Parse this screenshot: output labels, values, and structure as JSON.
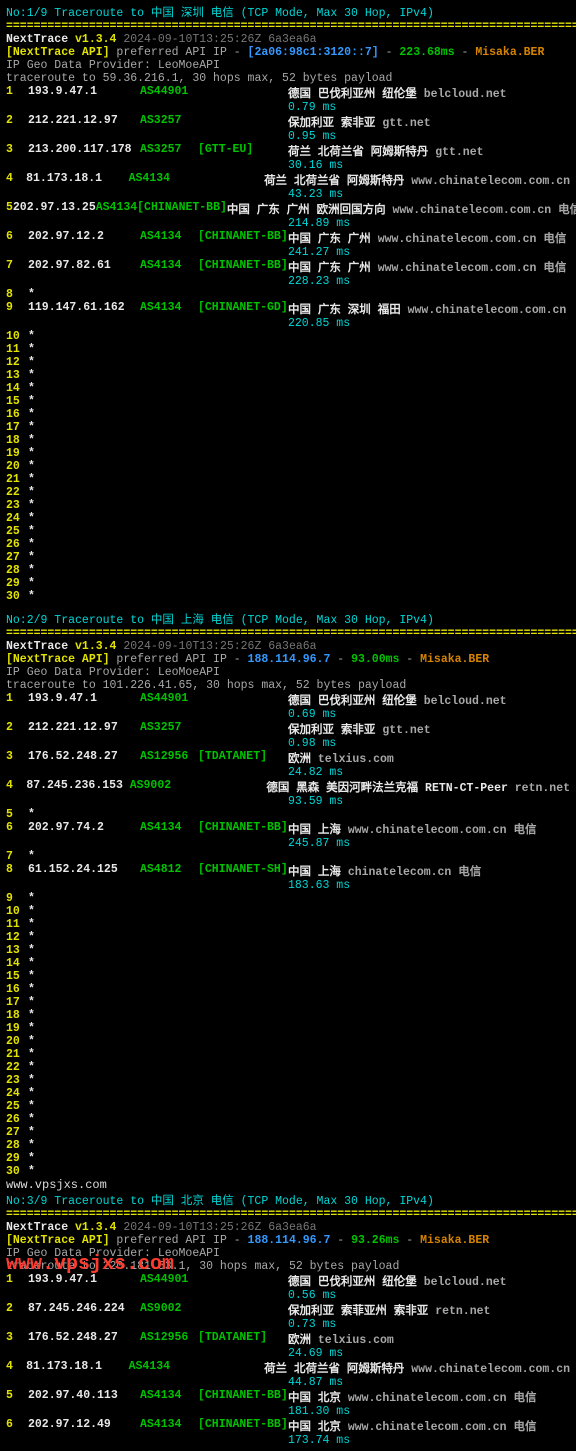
{
  "watermark": "www.vpsjxs.com",
  "blocks": [
    {
      "header": "No:1/9 Traceroute to 中国 深圳 电信 (TCP Mode, Max 30 Hop, IPv4)",
      "version": {
        "name": "NextTrace",
        "ver": "v1.3.4",
        "ts": "2024-09-10T13:25:26Z",
        "hash": "6a3ea6a"
      },
      "api_label": "[NextTrace API]",
      "api_text": "preferred API IP -",
      "api_ip": "[2a06:98c1:3120::7]",
      "api_sep": "-",
      "api_lat": "223.68ms",
      "api_sep2": "-",
      "api_node": "Misaka.BER",
      "provider": "IP Geo Data Provider: LeoMoeAPI",
      "target": "traceroute to 59.36.216.1, 30 hops max, 52 bytes payload",
      "hops": [
        {
          "n": "1",
          "ip": "193.9.47.1",
          "asn": "AS44901",
          "tag": "",
          "loc": "德国 巴伐利亚州 纽伦堡",
          "host": "belcloud.net",
          "peer": "",
          "lat": "0.79 ms"
        },
        {
          "n": "2",
          "ip": "212.221.12.97",
          "asn": "AS3257",
          "tag": "",
          "loc": "保加利亚 索非亚",
          "host": "gtt.net",
          "peer": "",
          "lat": "0.95 ms"
        },
        {
          "n": "3",
          "ip": "213.200.117.178",
          "asn": "AS3257",
          "tag": "[GTT-EU]",
          "loc": "荷兰 北荷兰省 阿姆斯特丹",
          "host": "gtt.net",
          "peer": "",
          "lat": "30.16 ms"
        },
        {
          "n": "4",
          "ip": "81.173.18.1",
          "asn": "AS4134",
          "tag": "",
          "loc": "荷兰 北荷兰省 阿姆斯特丹",
          "host": "www.chinatelecom.com.cn",
          "peer": "",
          "lat": "43.23 ms"
        },
        {
          "n": "5",
          "ip": "202.97.13.25",
          "asn": "AS4134",
          "tag": "[CHINANET-BB]",
          "loc": "中国 广东 广州 欧洲回国方向",
          "host": "www.chinatelecom.com.cn",
          "peer": "电信",
          "lat": "214.89 ms"
        },
        {
          "n": "6",
          "ip": "202.97.12.2",
          "asn": "AS4134",
          "tag": "[CHINANET-BB]",
          "loc": "中国 广东 广州",
          "host": "www.chinatelecom.com.cn",
          "peer": "电信",
          "lat": "241.27 ms"
        },
        {
          "n": "7",
          "ip": "202.97.82.61",
          "asn": "AS4134",
          "tag": "[CHINANET-BB]",
          "loc": "中国 广东 广州",
          "host": "www.chinatelecom.com.cn",
          "peer": "电信",
          "lat": "228.23 ms"
        },
        {
          "n": "8",
          "ip": "*",
          "asn": "",
          "tag": "",
          "loc": "",
          "host": "",
          "peer": "",
          "lat": ""
        },
        {
          "n": "9",
          "ip": "119.147.61.162",
          "asn": "AS4134",
          "tag": "[CHINANET-GD]",
          "loc": "中国 广东 深圳 福田",
          "host": "www.chinatelecom.com.cn",
          "peer": "",
          "lat": "220.85 ms"
        }
      ],
      "timeouts_from": 10,
      "timeouts_to": 30
    },
    {
      "header": "No:2/9 Traceroute to 中国 上海 电信 (TCP Mode, Max 30 Hop, IPv4)",
      "version": {
        "name": "NextTrace",
        "ver": "v1.3.4",
        "ts": "2024-09-10T13:25:26Z",
        "hash": "6a3ea6a"
      },
      "api_label": "[NextTrace API]",
      "api_text": "preferred API IP -",
      "api_ip": "188.114.96.7",
      "api_sep": "-",
      "api_lat": "93.00ms",
      "api_sep2": "-",
      "api_node": "Misaka.BER",
      "provider": "IP Geo Data Provider: LeoMoeAPI",
      "target": "traceroute to 101.226.41.65, 30 hops max, 52 bytes payload",
      "hops": [
        {
          "n": "1",
          "ip": "193.9.47.1",
          "asn": "AS44901",
          "tag": "",
          "loc": "德国 巴伐利亚州 纽伦堡",
          "host": "belcloud.net",
          "peer": "",
          "lat": "0.69 ms"
        },
        {
          "n": "2",
          "ip": "212.221.12.97",
          "asn": "AS3257",
          "tag": "",
          "loc": "保加利亚 索非亚",
          "host": "gtt.net",
          "peer": "",
          "lat": "0.98 ms"
        },
        {
          "n": "3",
          "ip": "176.52.248.27",
          "asn": "AS12956",
          "tag": "[TDATANET]",
          "loc": "欧洲",
          "host": "telxius.com",
          "peer": "",
          "lat": "24.82 ms"
        },
        {
          "n": "4",
          "ip": "87.245.236.153",
          "asn": "AS9002",
          "tag": "",
          "loc": "德国 黑森 美因河畔法兰克福 RETN-CT-Peer",
          "host": "retn.net",
          "peer": "",
          "lat": "93.59 ms"
        },
        {
          "n": "5",
          "ip": "*",
          "asn": "",
          "tag": "",
          "loc": "",
          "host": "",
          "peer": "",
          "lat": ""
        },
        {
          "n": "6",
          "ip": "202.97.74.2",
          "asn": "AS4134",
          "tag": "[CHINANET-BB]",
          "loc": "中国 上海",
          "host": "www.chinatelecom.com.cn",
          "peer": "电信",
          "lat": "245.87 ms"
        },
        {
          "n": "7",
          "ip": "*",
          "asn": "",
          "tag": "",
          "loc": "",
          "host": "",
          "peer": "",
          "lat": ""
        },
        {
          "n": "8",
          "ip": "61.152.24.125",
          "asn": "AS4812",
          "tag": "[CHINANET-SH]",
          "loc": "中国 上海",
          "host": "chinatelecom.cn",
          "peer": "电信",
          "lat": "183.63 ms"
        }
      ],
      "timeouts_from": 9,
      "timeouts_to": 30
    },
    {
      "header": "No:3/9 Traceroute to 中国 北京 电信 (TCP Mode, Max 30 Hop, IPv4)",
      "version": {
        "name": "NextTrace",
        "ver": "v1.3.4",
        "ts": "2024-09-10T13:25:26Z",
        "hash": "6a3ea6a"
      },
      "api_label": "[NextTrace API]",
      "api_text": "preferred API IP -",
      "api_ip": "188.114.96.7",
      "api_sep": "-",
      "api_lat": "93.26ms",
      "api_sep2": "-",
      "api_node": "Misaka.BER",
      "provider": "IP Geo Data Provider: LeoMoeAPI",
      "target": "traceroute to 220.181.53.1, 30 hops max, 52 bytes payload",
      "hops": [
        {
          "n": "1",
          "ip": "193.9.47.1",
          "asn": "AS44901",
          "tag": "",
          "loc": "德国 巴伐利亚州 纽伦堡",
          "host": "belcloud.net",
          "peer": "",
          "lat": "0.56 ms"
        },
        {
          "n": "2",
          "ip": "87.245.246.224",
          "asn": "AS9002",
          "tag": "",
          "loc": "保加利亚 索菲亚州 索非亚",
          "host": "retn.net",
          "peer": "",
          "lat": "0.73 ms"
        },
        {
          "n": "3",
          "ip": "176.52.248.27",
          "asn": "AS12956",
          "tag": "[TDATANET]",
          "loc": "欧洲",
          "host": "telxius.com",
          "peer": "",
          "lat": "24.69 ms"
        },
        {
          "n": "4",
          "ip": "81.173.18.1",
          "asn": "AS4134",
          "tag": "",
          "loc": "荷兰 北荷兰省 阿姆斯特丹",
          "host": "www.chinatelecom.com.cn",
          "peer": "",
          "lat": "44.87 ms"
        },
        {
          "n": "5",
          "ip": "202.97.40.113",
          "asn": "AS4134",
          "tag": "[CHINANET-BB]",
          "loc": "中国 北京",
          "host": "www.chinatelecom.com.cn",
          "peer": "电信",
          "lat": "181.30 ms"
        },
        {
          "n": "6",
          "ip": "202.97.12.49",
          "asn": "AS4134",
          "tag": "[CHINANET-BB]",
          "loc": "中国 北京",
          "host": "www.chinatelecom.com.cn",
          "peer": "电信",
          "lat": "173.74 ms"
        }
      ],
      "timeouts_from": 0,
      "timeouts_to": 0
    }
  ]
}
